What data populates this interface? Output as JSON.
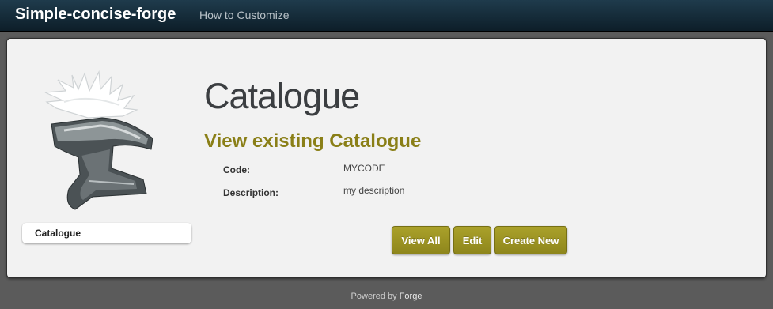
{
  "navbar": {
    "brand": "Simple-concise-forge",
    "links": [
      {
        "label": "How to Customize"
      }
    ]
  },
  "sidebar": {
    "logo_icon": "anvil-logo-icon",
    "items": [
      {
        "label": "Catalogue"
      }
    ]
  },
  "main": {
    "title": "Catalogue",
    "subtitle": "View existing Catalogue",
    "fields": [
      {
        "label": "Code:",
        "value": "MYCODE"
      },
      {
        "label": "Description:",
        "value": "my description"
      }
    ],
    "buttons": [
      {
        "label": "View All"
      },
      {
        "label": "Edit"
      },
      {
        "label": "Create New"
      }
    ]
  },
  "footer": {
    "text": "Powered by",
    "link": "Forge"
  },
  "colors": {
    "navbar": "#0d1e29",
    "accent": "#8a7f17",
    "button": "#9a921f",
    "background": "#5b5b5b",
    "panel": "#f2f2f2"
  }
}
